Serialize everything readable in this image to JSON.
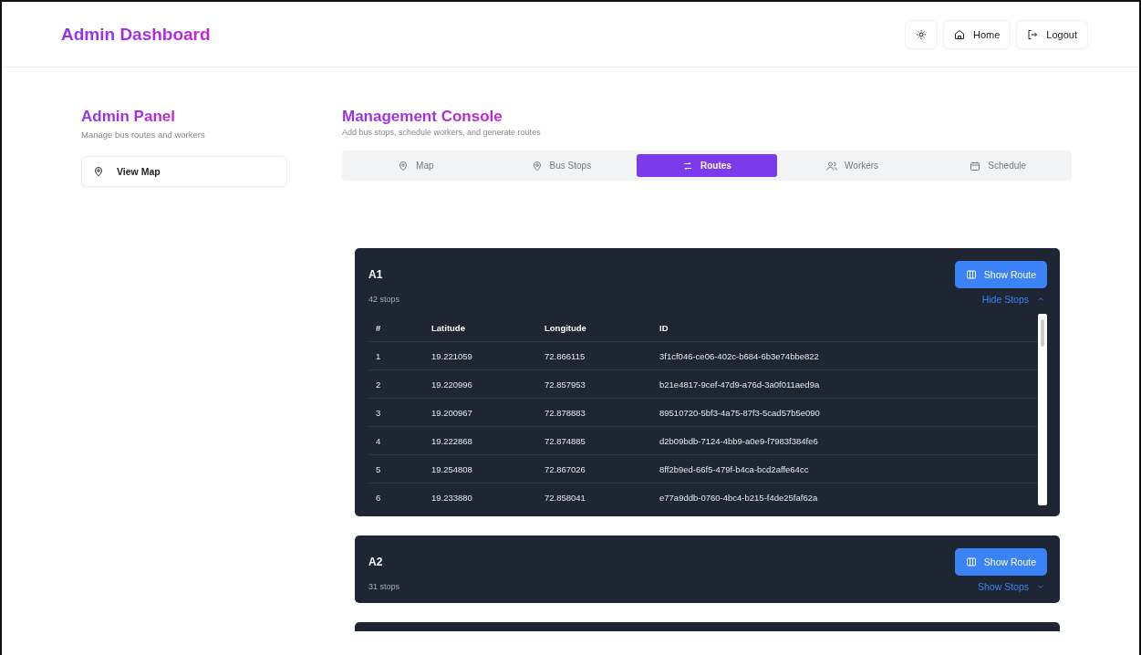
{
  "header": {
    "title": "Admin Dashboard",
    "actions": [
      {
        "kind": "theme"
      },
      {
        "kind": "home",
        "label": "Home"
      },
      {
        "kind": "logout",
        "label": "Logout"
      }
    ]
  },
  "sidebar": {
    "title": "Admin Panel",
    "subtitle": "Manage bus routes and workers",
    "items": [
      {
        "label": "View Map"
      }
    ]
  },
  "main": {
    "title": "Management Console",
    "subtitle": "Add bus stops, schedule workers, and generate routes",
    "tabs": [
      {
        "label": "Map",
        "kind": "map",
        "selected": false
      },
      {
        "label": "Bus Stops",
        "kind": "stops",
        "selected": false
      },
      {
        "label": "Routes",
        "kind": "routes",
        "selected": true
      },
      {
        "label": "Workers",
        "kind": "workers",
        "selected": false
      },
      {
        "label": "Schedule",
        "kind": "schedule",
        "selected": false
      }
    ]
  },
  "routes": [
    {
      "name": "A1",
      "stops": "42 stops",
      "button": "Show Route",
      "toggle": "Hide Stops",
      "expanded": true,
      "columns": [
        "#",
        "Latitude",
        "Longitude",
        "ID"
      ],
      "rows": [
        [
          "1",
          "19.221059",
          "72.866115",
          "3f1cf046-ce06-402c-b684-6b3e74bbe822"
        ],
        [
          "2",
          "19.220996",
          "72.857953",
          "b21e4817-9cef-47d9-a76d-3a0f011aed9a"
        ],
        [
          "3",
          "19.200967",
          "72.878883",
          "89510720-5bf3-4a75-87f3-5cad57b5e090"
        ],
        [
          "4",
          "19.222868",
          "72.874885",
          "d2b09bdb-7124-4bb9-a0e9-f7983f384fe6"
        ],
        [
          "5",
          "19.254808",
          "72.867026",
          "8ff2b9ed-66f5-479f-b4ca-bcd2affe64cc"
        ],
        [
          "6",
          "19.233880",
          "72.858041",
          "e77a9ddb-0760-4bc4-b215-f4de25faf62a"
        ]
      ]
    },
    {
      "name": "A2",
      "stops": "31 stops",
      "button": "Show Route",
      "toggle": "Show Stops",
      "expanded": false
    },
    {
      "kind": "partial"
    }
  ]
}
